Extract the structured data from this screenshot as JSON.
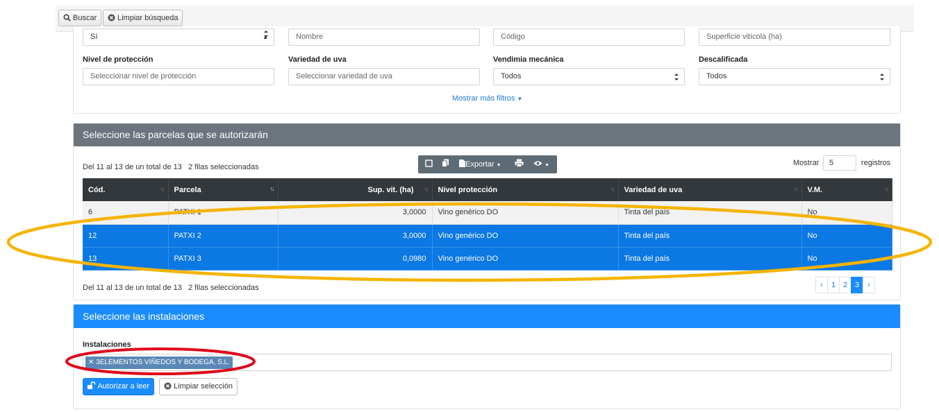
{
  "toolbar": {
    "search_label": "Buscar",
    "clear_search_label": "Limpiar búsqueda"
  },
  "filters": {
    "row1": {
      "first_value": "Sí",
      "name_placeholder": "Nombre",
      "code_placeholder": "Código",
      "surface_placeholder": "Superficie vitícola (ha)"
    },
    "protection": {
      "label": "Nivel de protección",
      "placeholder": "Seleccionar nivel de protección"
    },
    "grape": {
      "label": "Variedad de uva",
      "placeholder": "Seleccionar variedad de uva"
    },
    "mechanical": {
      "label": "Vendimia mecánica",
      "value": "Todos"
    },
    "declassified": {
      "label": "Descalificada",
      "value": "Todos"
    },
    "more_filters_label": "Mostrar más filtros"
  },
  "parcels_panel": {
    "title": "Seleccione las parcelas que se autorizarán",
    "info_top": "Del 11 al 13 de un total de 13",
    "selected_top": "2 filas seleccionadas",
    "info_bottom": "Del 11 al 13 de un total de 13",
    "selected_bottom": "2 filas seleccionadas",
    "export_label": "Exportar",
    "length_prefix": "Mostrar",
    "length_value": "5",
    "length_suffix": "registros",
    "columns": [
      "Cód.",
      "Parcela",
      "Sup. vit. (ha)",
      "Nivel protección",
      "Variedad de uva",
      "V.M."
    ],
    "rows": [
      {
        "code": "6",
        "parcel": "PATXI 1",
        "surface": "3,0000",
        "protection": "Vino genérico DO",
        "grape": "Tinta del país",
        "vm": "No",
        "selected": false
      },
      {
        "code": "12",
        "parcel": "PATXI 2",
        "surface": "3,0000",
        "protection": "Vino genérico DO",
        "grape": "Tinta del país",
        "vm": "No",
        "selected": true
      },
      {
        "code": "13",
        "parcel": "PATXI 3",
        "surface": "0,0980",
        "protection": "Vino genérico DO",
        "grape": "Tinta del país",
        "vm": "No",
        "selected": true
      }
    ],
    "pagination": {
      "prev": "‹",
      "pages": [
        "1",
        "2",
        "3"
      ],
      "current": "3",
      "next": "›"
    }
  },
  "installations_panel": {
    "title": "Seleccione las instalaciones",
    "label": "Instalaciones",
    "selected_tag": "3ELEMENTOS VIÑEDOS Y BODEGA, S.L.",
    "authorize_label": "Autorizar a leer",
    "clear_selection_label": "Limpiar selección"
  },
  "colors": {
    "selected_row": "#0b78e3",
    "primary": "#1a8cff",
    "panel_header_gray": "#6c757d",
    "table_header": "#33383c",
    "highlight_yellow": "#f5b400",
    "highlight_red": "#e0001b"
  }
}
